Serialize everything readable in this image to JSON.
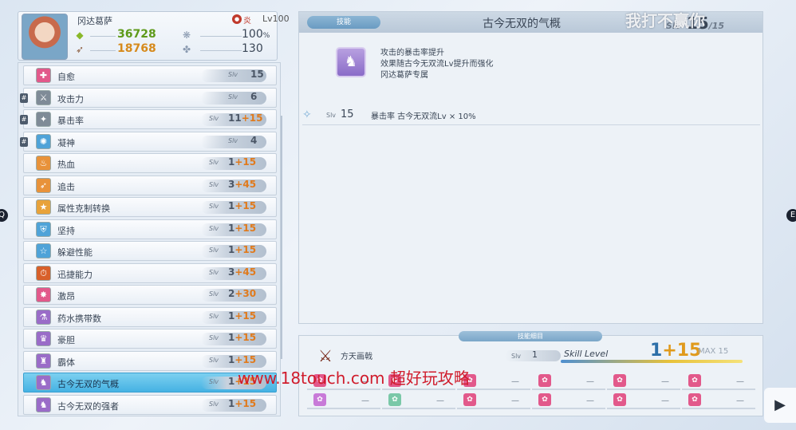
{
  "nav": {
    "left_key": "Q",
    "right_key": "E"
  },
  "character": {
    "name": "冈达葛萨",
    "element_label": "炎",
    "level_label": "Lv100",
    "hp": "36728",
    "hp_pct": "100",
    "pct_unit": "%",
    "atk": "18768",
    "secondary": "130"
  },
  "skills": [
    {
      "name": "自愈",
      "slv": "15",
      "plus": "",
      "color": "#e2598b",
      "pinned": false,
      "selected": false
    },
    {
      "name": "攻击力",
      "slv": "6",
      "plus": "",
      "color": "#7f8b97",
      "pinned": true,
      "selected": false
    },
    {
      "name": "暴击率",
      "slv": "11",
      "plus": "15",
      "color": "#7f8b97",
      "pinned": true,
      "selected": false
    },
    {
      "name": "凝神",
      "slv": "4",
      "plus": "",
      "color": "#4fa3d8",
      "pinned": true,
      "selected": false
    },
    {
      "name": "热血",
      "slv": "1",
      "plus": "15",
      "color": "#e8923a",
      "pinned": false,
      "selected": false
    },
    {
      "name": "追击",
      "slv": "3",
      "plus": "45",
      "color": "#e8923a",
      "pinned": false,
      "selected": false
    },
    {
      "name": "属性克制转换",
      "slv": "1",
      "plus": "15",
      "color": "#e8a23a",
      "pinned": false,
      "selected": false
    },
    {
      "name": "坚持",
      "slv": "1",
      "plus": "15",
      "color": "#4fa3d8",
      "pinned": false,
      "selected": false
    },
    {
      "name": "躲避性能",
      "slv": "1",
      "plus": "15",
      "color": "#4fa3d8",
      "pinned": false,
      "selected": false
    },
    {
      "name": "迅捷能力",
      "slv": "3",
      "plus": "45",
      "color": "#d8602a",
      "pinned": false,
      "selected": false
    },
    {
      "name": "激昂",
      "slv": "2",
      "plus": "30",
      "color": "#e2598b",
      "pinned": false,
      "selected": false
    },
    {
      "name": "药水携带数",
      "slv": "1",
      "plus": "15",
      "color": "#9a6cc8",
      "pinned": false,
      "selected": false
    },
    {
      "name": "豪胆",
      "slv": "1",
      "plus": "15",
      "color": "#9a6cc8",
      "pinned": false,
      "selected": false
    },
    {
      "name": "霸体",
      "slv": "1",
      "plus": "15",
      "color": "#9a6cc8",
      "pinned": false,
      "selected": false
    },
    {
      "name": "古今无双的气概",
      "slv": "1",
      "plus": "15",
      "color": "#9a6cc8",
      "pinned": false,
      "selected": true
    },
    {
      "name": "古今无双的强者",
      "slv": "1",
      "plus": "15",
      "color": "#9a6cc8",
      "pinned": false,
      "selected": false
    }
  ],
  "detail": {
    "tag": "技能",
    "title": "古今无双的气概",
    "header_slv_tag": "Slv",
    "header_slv": "15",
    "header_slv_max": "15",
    "desc_lines": [
      "攻击的暴击率提升",
      "效果随古今无双流Lv提升而强化",
      "冈达葛萨专属"
    ],
    "effect_slv_tag": "Slv",
    "effect_slv": "15",
    "effect_text": "暴击率 古今无双流Lv × 10%"
  },
  "bottom": {
    "tag": "技能细目",
    "weapon_name": "方天画戟",
    "weapon_slv_tag": "Slv",
    "weapon_slv": "1",
    "skill_level_label": "Skill Level",
    "skill_level_base": "1",
    "skill_level_plus": "15",
    "skill_level_max": "MAX 15",
    "slot_dash": "—",
    "slots_row1": [
      "#e2598b",
      "#e2598b",
      "#e2598b",
      "#e2598b",
      "#e2598b",
      "#e2598b"
    ],
    "slots_row2": [
      "#c87ad8",
      "#7ac8a8",
      "#e2598b",
      "#e2598b",
      "#e2598b",
      "#e2598b"
    ]
  },
  "watermarks": {
    "top": "我打不赢你",
    "middle": "www.18touch.com 超好玩攻略"
  },
  "icons": {
    "element": "fire-element-icon",
    "hp": "hp-gem-icon",
    "atk": "attack-arrow-icon",
    "ability": "ability-emblem-icon",
    "weapon": "halberd-icon",
    "effect": "sparkle-icon"
  }
}
